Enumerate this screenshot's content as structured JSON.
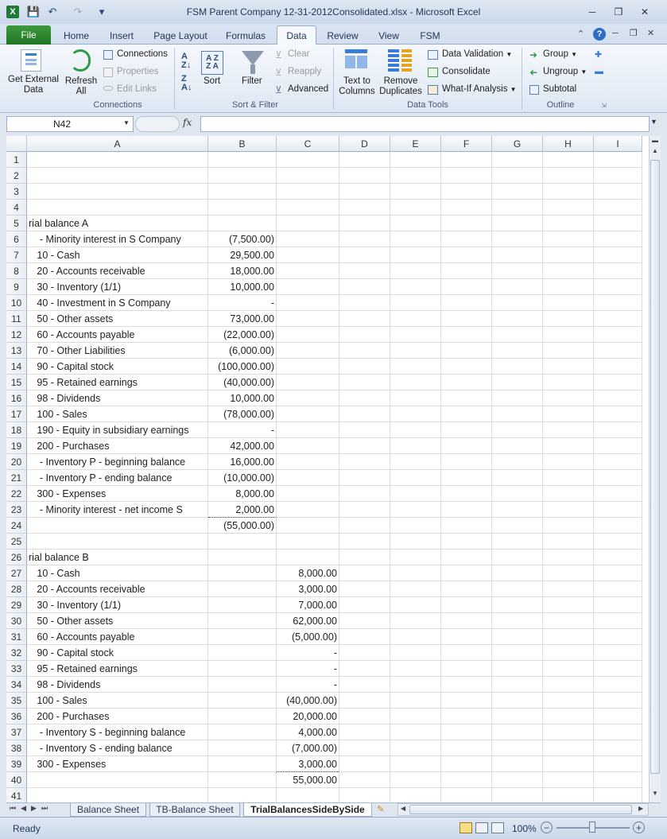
{
  "window": {
    "title": "FSM Parent Company 12-31-2012Consolidated.xlsx  -  Microsoft Excel",
    "qat": {
      "save": "💾",
      "undo": "↶",
      "redo": "↷",
      "customize": "▾"
    },
    "controls": {
      "minimize": "─",
      "restore": "❐",
      "close": "✕"
    }
  },
  "ribbon_tabs": [
    "File",
    "Home",
    "Insert",
    "Page Layout",
    "Formulas",
    "Data",
    "Review",
    "View",
    "FSM"
  ],
  "active_tab": "Data",
  "ribbon": {
    "connections_group": {
      "label": "Connections",
      "get_external_data": "Get External Data",
      "refresh_all": "Refresh All",
      "connections": "Connections",
      "properties": "Properties",
      "edit_links": "Edit Links"
    },
    "sort_filter_group": {
      "label": "Sort & Filter",
      "sort": "Sort",
      "filter": "Filter",
      "clear": "Clear",
      "reapply": "Reapply",
      "advanced": "Advanced"
    },
    "data_tools_group": {
      "label": "Data Tools",
      "text_to_columns": "Text to Columns",
      "remove_duplicates": "Remove Duplicates",
      "data_validation": "Data Validation",
      "consolidate": "Consolidate",
      "what_if": "What-If Analysis"
    },
    "outline_group": {
      "label": "Outline",
      "group": "Group",
      "ungroup": "Ungroup",
      "subtotal": "Subtotal"
    }
  },
  "name_box": "N42",
  "fx_label": "fx",
  "formula_value": "",
  "columns": [
    "A",
    "B",
    "C",
    "D",
    "E",
    "F",
    "G",
    "H",
    "I"
  ],
  "rows": [
    {
      "n": "1",
      "a": "",
      "b": "",
      "c": ""
    },
    {
      "n": "2",
      "a": "",
      "b": "",
      "c": ""
    },
    {
      "n": "3",
      "a": "",
      "b": "",
      "c": ""
    },
    {
      "n": "4",
      "a": "",
      "b": "",
      "c": ""
    },
    {
      "n": "5",
      "a": "rial balance A",
      "b": "",
      "c": ""
    },
    {
      "n": "6",
      "a": "    - Minority interest in S Company",
      "b": "(7,500.00)",
      "c": ""
    },
    {
      "n": "7",
      "a": "   10 - Cash",
      "b": "29,500.00",
      "c": ""
    },
    {
      "n": "8",
      "a": "   20 - Accounts receivable",
      "b": "18,000.00",
      "c": ""
    },
    {
      "n": "9",
      "a": "   30 - Inventory (1/1)",
      "b": "10,000.00",
      "c": ""
    },
    {
      "n": "10",
      "a": "   40 - Investment in S Company",
      "b": "-",
      "c": ""
    },
    {
      "n": "11",
      "a": "   50 - Other assets",
      "b": "73,000.00",
      "c": ""
    },
    {
      "n": "12",
      "a": "   60 - Accounts payable",
      "b": "(22,000.00)",
      "c": ""
    },
    {
      "n": "13",
      "a": "   70 - Other Liabilities",
      "b": "(6,000.00)",
      "c": ""
    },
    {
      "n": "14",
      "a": "   90 - Capital stock",
      "b": "(100,000.00)",
      "c": ""
    },
    {
      "n": "15",
      "a": "   95 - Retained earnings",
      "b": "(40,000.00)",
      "c": ""
    },
    {
      "n": "16",
      "a": "   98 - Dividends",
      "b": "10,000.00",
      "c": ""
    },
    {
      "n": "17",
      "a": "   100 - Sales",
      "b": "(78,000.00)",
      "c": ""
    },
    {
      "n": "18",
      "a": "   190 - Equity in subsidiary earnings",
      "b": "-",
      "c": ""
    },
    {
      "n": "19",
      "a": "   200 - Purchases",
      "b": "42,000.00",
      "c": ""
    },
    {
      "n": "20",
      "a": "    - Inventory P - beginning balance",
      "b": "16,000.00",
      "c": ""
    },
    {
      "n": "21",
      "a": "    - Inventory P - ending balance",
      "b": "(10,000.00)",
      "c": ""
    },
    {
      "n": "22",
      "a": "   300 - Expenses",
      "b": "8,000.00",
      "c": ""
    },
    {
      "n": "23",
      "a": "    - Minority interest - net income S",
      "b": "2,000.00",
      "c": ""
    },
    {
      "n": "24",
      "a": "",
      "b": "(55,000.00)",
      "c": ""
    },
    {
      "n": "25",
      "a": "",
      "b": "",
      "c": ""
    },
    {
      "n": "26",
      "a": "rial balance B",
      "b": "",
      "c": ""
    },
    {
      "n": "27",
      "a": "   10 - Cash",
      "b": "",
      "c": "8,000.00"
    },
    {
      "n": "28",
      "a": "   20 - Accounts receivable",
      "b": "",
      "c": "3,000.00"
    },
    {
      "n": "29",
      "a": "   30 - Inventory (1/1)",
      "b": "",
      "c": "7,000.00"
    },
    {
      "n": "30",
      "a": "   50 - Other assets",
      "b": "",
      "c": "62,000.00"
    },
    {
      "n": "31",
      "a": "   60 - Accounts payable",
      "b": "",
      "c": "(5,000.00)"
    },
    {
      "n": "32",
      "a": "   90 - Capital stock",
      "b": "",
      "c": "-"
    },
    {
      "n": "33",
      "a": "   95 - Retained earnings",
      "b": "",
      "c": "-"
    },
    {
      "n": "34",
      "a": "   98 - Dividends",
      "b": "",
      "c": "-"
    },
    {
      "n": "35",
      "a": "   100 - Sales",
      "b": "",
      "c": "(40,000.00)"
    },
    {
      "n": "36",
      "a": "   200 - Purchases",
      "b": "",
      "c": "20,000.00"
    },
    {
      "n": "37",
      "a": "    - Inventory S - beginning balance",
      "b": "",
      "c": "4,000.00"
    },
    {
      "n": "38",
      "a": "    - Inventory S - ending balance",
      "b": "",
      "c": "(7,000.00)"
    },
    {
      "n": "39",
      "a": "   300 - Expenses",
      "b": "",
      "c": "3,000.00"
    },
    {
      "n": "40",
      "a": "",
      "b": "",
      "c": "55,000.00"
    },
    {
      "n": "41",
      "a": "",
      "b": "",
      "c": ""
    }
  ],
  "sheet_tabs": [
    "Balance Sheet",
    "TB-Balance Sheet",
    "TrialBalancesSideBySide"
  ],
  "active_sheet": "TrialBalancesSideBySide",
  "status": {
    "ready": "Ready",
    "zoom": "100%"
  }
}
